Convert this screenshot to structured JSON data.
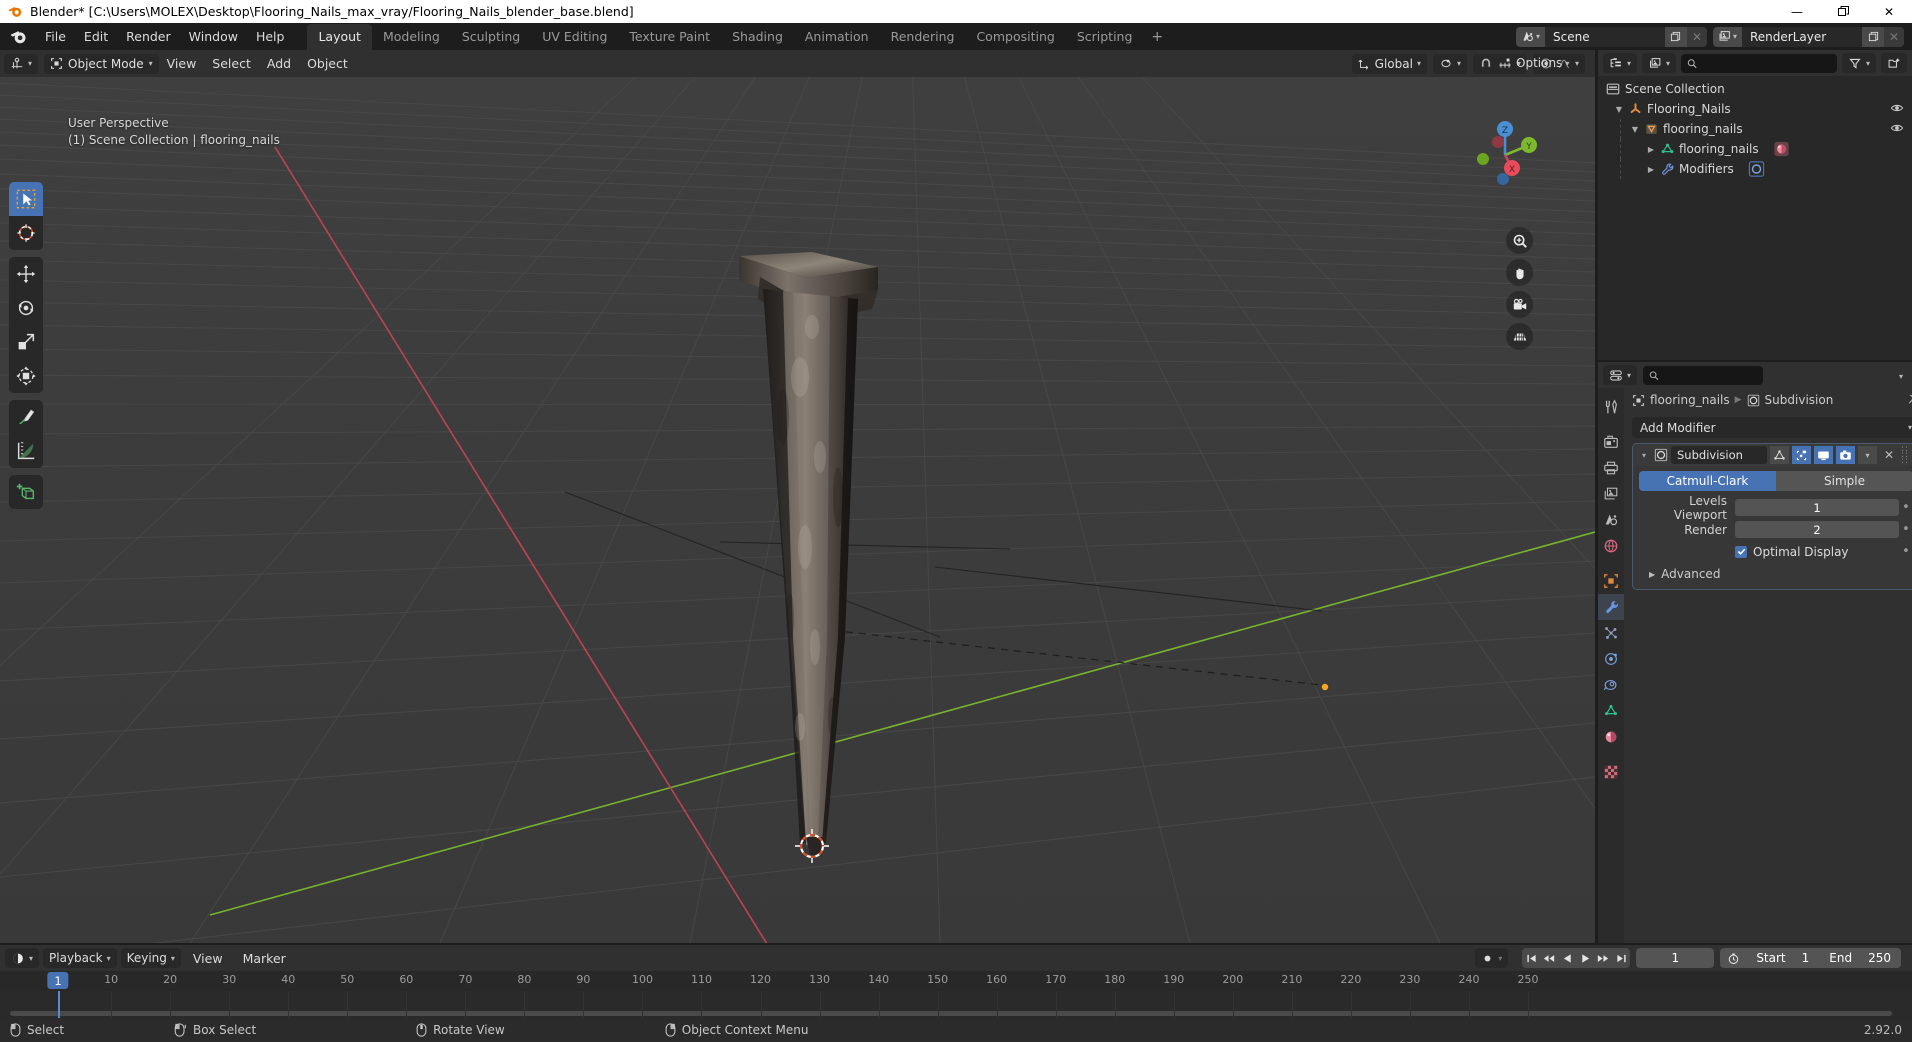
{
  "window": {
    "title": "Blender* [C:\\Users\\MOLEX\\Desktop\\Flooring_Nails_max_vray/Flooring_Nails_blender_base.blend]",
    "minimize": "—",
    "maximize": "❐",
    "close": "✕"
  },
  "topbar": {
    "menus": [
      "File",
      "Edit",
      "Render",
      "Window",
      "Help"
    ],
    "workspaces": [
      {
        "label": "Layout",
        "active": true
      },
      {
        "label": "Modeling",
        "active": false
      },
      {
        "label": "Sculpting",
        "active": false
      },
      {
        "label": "UV Editing",
        "active": false
      },
      {
        "label": "Texture Paint",
        "active": false
      },
      {
        "label": "Shading",
        "active": false
      },
      {
        "label": "Animation",
        "active": false
      },
      {
        "label": "Rendering",
        "active": false
      },
      {
        "label": "Compositing",
        "active": false
      },
      {
        "label": "Scripting",
        "active": false
      }
    ],
    "add_workspace": "+",
    "scene_name": "Scene",
    "viewlayer_name": "RenderLayer"
  },
  "viewport": {
    "header": {
      "mode": "Object Mode",
      "menus": [
        "View",
        "Select",
        "Add",
        "Object"
      ],
      "transform_orientation": "Global",
      "options_label": "Options"
    },
    "overlay": {
      "perspective": "User Perspective",
      "context": "(1) Scene Collection | flooring_nails"
    },
    "gizmo": {
      "x": "X",
      "y": "Y",
      "z": "Z"
    },
    "tools": [
      "tweak-select-tool",
      "cursor-tool",
      "move-tool",
      "rotate-tool",
      "scale-tool",
      "transform-tool",
      "annotate-tool",
      "measure-tool",
      "add-cube-tool"
    ],
    "nav_buttons": [
      "zoom-icon",
      "pan-hand-icon",
      "camera-icon",
      "ortho-grid-icon"
    ]
  },
  "outliner": {
    "search_placeholder": "",
    "search_value": "",
    "rows": [
      {
        "label": "Scene Collection",
        "icon": "collection-icon",
        "depth": 0,
        "disclosure": "",
        "eye": false,
        "selected": false
      },
      {
        "label": "Flooring_Nails",
        "icon": "collection-empty-icon",
        "depth": 1,
        "disclosure": "▼",
        "eye": true,
        "selected": false
      },
      {
        "label": "flooring_nails",
        "icon": "object-mesh-icon",
        "depth": 2,
        "disclosure": "▼",
        "eye": true,
        "selected": false
      },
      {
        "label": "flooring_nails",
        "icon": "mesh-data-icon",
        "depth": 3,
        "disclosure": "▶",
        "eye": false,
        "selected": false,
        "extra_icon": "material-icon"
      },
      {
        "label": "Modifiers",
        "icon": "wrench-icon",
        "depth": 3,
        "disclosure": "▶",
        "eye": false,
        "selected": false,
        "extra_icon": "subdivision-icon"
      }
    ]
  },
  "properties": {
    "search_value": "",
    "breadcrumb": {
      "object": "flooring_nails",
      "modifier": "Subdivision"
    },
    "add_modifier_label": "Add Modifier",
    "modifier": {
      "name": "Subdivision",
      "algorithms": [
        {
          "label": "Catmull-Clark",
          "active": true
        },
        {
          "label": "Simple",
          "active": false
        }
      ],
      "fields": [
        {
          "label": "Levels Viewport",
          "value": "1"
        },
        {
          "label": "Render",
          "value": "2"
        }
      ],
      "optimal_display": {
        "label": "Optimal Display",
        "checked": true
      },
      "advanced_label": "Advanced",
      "header_toggles": [
        "edit-mode-cage-icon",
        "edit-mode-icon",
        "realtime-icon",
        "render-icon"
      ],
      "dropdown_icon": "chevron-down-icon",
      "close_icon": "✕",
      "grip_icon": "::::"
    },
    "tabs": [
      "tool-icon",
      "render-icon",
      "output-icon",
      "view-layer-icon",
      "scene-icon",
      "world-icon",
      "object-icon",
      "modifier-icon",
      "particles-icon",
      "physics-icon",
      "constraints-icon",
      "data-icon",
      "material-icon",
      "texture-icon"
    ],
    "selected_tab": "modifier-icon"
  },
  "timeline": {
    "menus": [
      "Playback",
      "Keying",
      "View",
      "Marker"
    ],
    "current_frame": "1",
    "start_label": "Start",
    "start_value": "1",
    "end_label": "End",
    "end_value": "250",
    "playhead_frame": 1,
    "ruler_ticks": [
      {
        "label": "1",
        "frame": 1
      },
      {
        "label": "10",
        "frame": 10
      },
      {
        "label": "20",
        "frame": 20
      },
      {
        "label": "30",
        "frame": 30
      },
      {
        "label": "40",
        "frame": 40
      },
      {
        "label": "50",
        "frame": 50
      },
      {
        "label": "60",
        "frame": 60
      },
      {
        "label": "70",
        "frame": 70
      },
      {
        "label": "80",
        "frame": 80
      },
      {
        "label": "90",
        "frame": 90
      },
      {
        "label": "100",
        "frame": 100
      },
      {
        "label": "110",
        "frame": 110
      },
      {
        "label": "120",
        "frame": 120
      },
      {
        "label": "130",
        "frame": 130
      },
      {
        "label": "140",
        "frame": 140
      },
      {
        "label": "150",
        "frame": 150
      },
      {
        "label": "160",
        "frame": 160
      },
      {
        "label": "170",
        "frame": 170
      },
      {
        "label": "180",
        "frame": 180
      },
      {
        "label": "190",
        "frame": 190
      },
      {
        "label": "200",
        "frame": 200
      },
      {
        "label": "210",
        "frame": 210
      },
      {
        "label": "220",
        "frame": 220
      },
      {
        "label": "230",
        "frame": 230
      },
      {
        "label": "240",
        "frame": 240
      },
      {
        "label": "250",
        "frame": 250
      }
    ]
  },
  "statusbar": {
    "items": [
      {
        "label": "Select",
        "icon": "mouse-left-icon"
      },
      {
        "label": "Box Select",
        "icon": "mouse-drag-icon"
      },
      {
        "label": "Rotate View",
        "icon": "mouse-middle-icon"
      },
      {
        "label": "Object Context Menu",
        "icon": "mouse-right-icon"
      }
    ],
    "version": "2.92.0"
  },
  "colors": {
    "accent": "#4772b3",
    "header_bg": "#303030",
    "viewport_bg": "#3d3d3d",
    "panel_bg": "#282828",
    "axis_x": "#cc4455",
    "axis_y": "#7db82f"
  }
}
